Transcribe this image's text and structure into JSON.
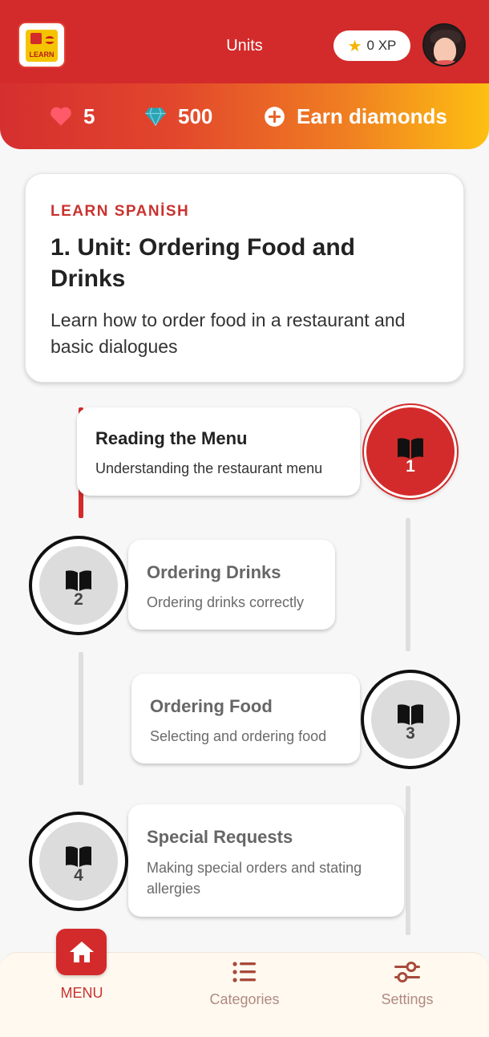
{
  "header": {
    "title": "Units",
    "logo_text": "LEARN",
    "xp_label": "0 XP",
    "avatar_alt": "avatar"
  },
  "stats": {
    "hearts": "5",
    "diamonds": "500",
    "earn_label": "Earn diamonds"
  },
  "unit": {
    "kicker": "LEARN SPANİSH",
    "title": "1. Unit: Ordering Food and Drinks",
    "description": "Learn how to order food in a restaurant and basic dialogues"
  },
  "lessons": [
    {
      "number": "1",
      "title": "Reading the Menu",
      "description": "Understanding the restaurant menu",
      "state": "active"
    },
    {
      "number": "2",
      "title": "Ordering Drinks",
      "description": "Ordering drinks correctly",
      "state": "locked"
    },
    {
      "number": "3",
      "title": "Ordering Food",
      "description": "Selecting and ordering food",
      "state": "locked"
    },
    {
      "number": "4",
      "title": "Special Requests",
      "description": "Making special orders and stating allergies",
      "state": "locked"
    }
  ],
  "nav": {
    "items": [
      {
        "label": "MENU",
        "icon": "home-icon",
        "active": true
      },
      {
        "label": "Categories",
        "icon": "list-icon",
        "active": false
      },
      {
        "label": "Settings",
        "icon": "sliders-icon",
        "active": false
      }
    ]
  },
  "colors": {
    "primary": "#d32b2b",
    "accent_gold": "#fdc012",
    "heart": "#ff5a6a",
    "diamond": "#2aa3b5",
    "nav_inactive": "#b08a80"
  }
}
